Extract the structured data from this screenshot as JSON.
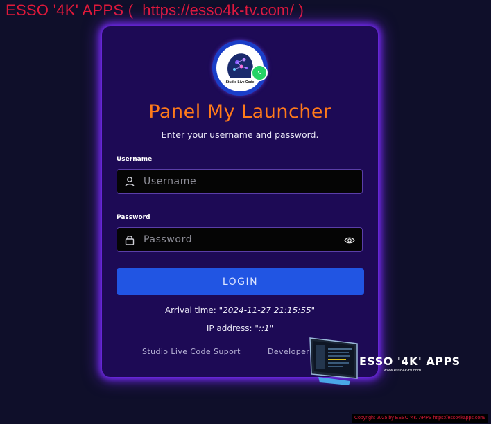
{
  "banner": {
    "text": "ESSO '4K' APPS (  https://esso4k-tv.com/ )"
  },
  "logo": {
    "caption": "Studio Live Code",
    "badge_icon": "whatsapp-icon"
  },
  "login": {
    "title": "Panel My Launcher",
    "subtitle": "Enter your username and password.",
    "username_label": "Username",
    "username_placeholder": "Username",
    "password_label": "Password",
    "password_placeholder": "Password",
    "button_label": "LOGIN"
  },
  "info": {
    "arrival_label": "Arrival time: ",
    "arrival_value": "\"2024-11-27 21:15:55\"",
    "ip_label": "IP address: ",
    "ip_value": "\"::1\""
  },
  "footer": {
    "support_link": "Studio Live Code Suport",
    "developer_link": "Developer"
  },
  "promo": {
    "title": "ESSO '4K' APPS",
    "url": "www.esso4k-tv.com"
  },
  "copyright": {
    "text": "Copyright 2025  by ESSO '4K' APPS https://esso4kapps.com/"
  },
  "colors": {
    "background": "#0f0f2a",
    "card": "#1d0a55",
    "glow": "#7b2cff",
    "title": "#ff7a1a",
    "button": "#2155e3",
    "banner": "#e0193a"
  }
}
